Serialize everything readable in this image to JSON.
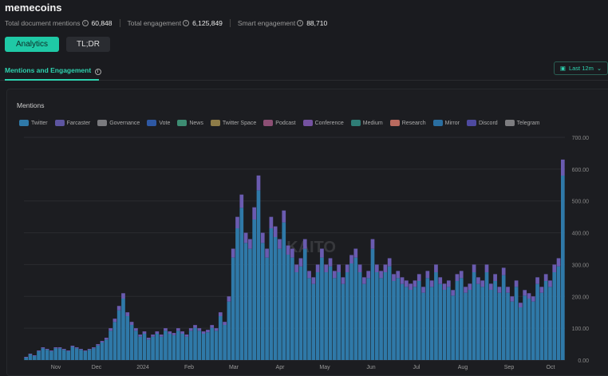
{
  "title": "memecoins",
  "stats": [
    {
      "label": "Total document mentions",
      "value": "60,848"
    },
    {
      "label": "Total engagement",
      "value": "6,125,849"
    },
    {
      "label": "Smart engagement",
      "value": "88,710"
    }
  ],
  "tabs": {
    "analytics": "Analytics",
    "tldr": "TL;DR"
  },
  "section": "Mentions and Engagement",
  "range": "Last 12m",
  "info": "i",
  "watermark": "KAITO",
  "chart_data": {
    "type": "bar",
    "title": "Mentions",
    "stacked": true,
    "legend": [
      {
        "name": "Twitter",
        "color": "#2f79a8"
      },
      {
        "name": "Farcaster",
        "color": "#5d55a0"
      },
      {
        "name": "Governance",
        "color": "#7a7a7e"
      },
      {
        "name": "Vote",
        "color": "#2e58a3"
      },
      {
        "name": "News",
        "color": "#3d8c72"
      },
      {
        "name": "Twitter Space",
        "color": "#8e7c48"
      },
      {
        "name": "Podcast",
        "color": "#8c4f74"
      },
      {
        "name": "Conference",
        "color": "#7452a0"
      },
      {
        "name": "Medium",
        "color": "#2f7d76"
      },
      {
        "name": "Research",
        "color": "#b86a5f"
      },
      {
        "name": "Mirror",
        "color": "#2a6ea0"
      },
      {
        "name": "Discord",
        "color": "#4e4aa0"
      },
      {
        "name": "Telegram",
        "color": "#7d7d80"
      }
    ],
    "x_ticks": [
      "Nov",
      "Dec",
      "2024",
      "Feb",
      "Mar",
      "Apr",
      "May",
      "Jun",
      "Jul",
      "Aug",
      "Sep",
      "Oct"
    ],
    "y_ticks": [
      "0.00",
      "100.00",
      "200.00",
      "300.00",
      "400.00",
      "500.00",
      "600.00",
      "700.00"
    ],
    "ylim": [
      0,
      700
    ],
    "values": [
      10,
      20,
      15,
      30,
      40,
      35,
      30,
      40,
      40,
      35,
      30,
      45,
      40,
      35,
      30,
      35,
      40,
      50,
      60,
      70,
      100,
      130,
      170,
      210,
      150,
      120,
      100,
      80,
      90,
      70,
      80,
      90,
      80,
      100,
      90,
      85,
      100,
      90,
      80,
      100,
      110,
      100,
      90,
      95,
      110,
      100,
      150,
      120,
      200,
      350,
      450,
      520,
      400,
      380,
      480,
      580,
      400,
      350,
      450,
      420,
      380,
      470,
      360,
      350,
      300,
      320,
      380,
      280,
      260,
      300,
      350,
      300,
      320,
      280,
      300,
      260,
      300,
      330,
      350,
      300,
      260,
      280,
      380,
      300,
      280,
      300,
      320,
      270,
      280,
      260,
      250,
      240,
      250,
      270,
      230,
      280,
      250,
      300,
      260,
      240,
      250,
      220,
      270,
      280,
      230,
      240,
      300,
      260,
      250,
      300,
      240,
      270,
      230,
      290,
      230,
      200,
      250,
      180,
      220,
      210,
      200,
      260,
      230,
      270,
      250,
      300,
      320,
      630
    ]
  }
}
